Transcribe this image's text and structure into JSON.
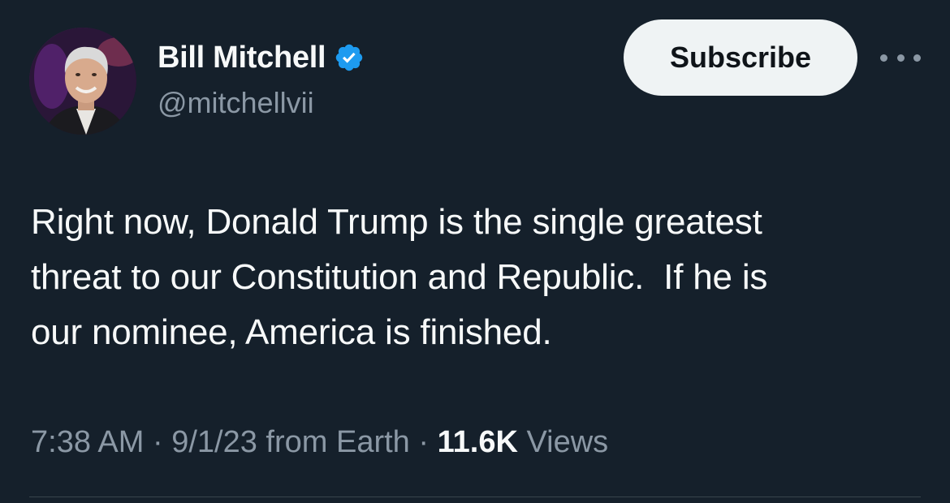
{
  "author": {
    "display_name": "Bill Mitchell",
    "handle": "@mitchellvii",
    "verified": true
  },
  "actions": {
    "subscribe_label": "Subscribe",
    "more_icon": "more-horizontal-icon"
  },
  "tweet": {
    "text": "Right now, Donald Trump is the single greatest\nthreat to our Constitution and Republic.  If he is\nour nominee, America is finished."
  },
  "meta": {
    "time": "7:38 AM",
    "separator": " · ",
    "date": "9/1/23",
    "source": "from Earth",
    "views_count": "11.6K",
    "views_label": "Views"
  },
  "colors": {
    "background": "#15202b",
    "verified_badge": "#1d9bf0",
    "secondary_text": "#8b98a5"
  }
}
